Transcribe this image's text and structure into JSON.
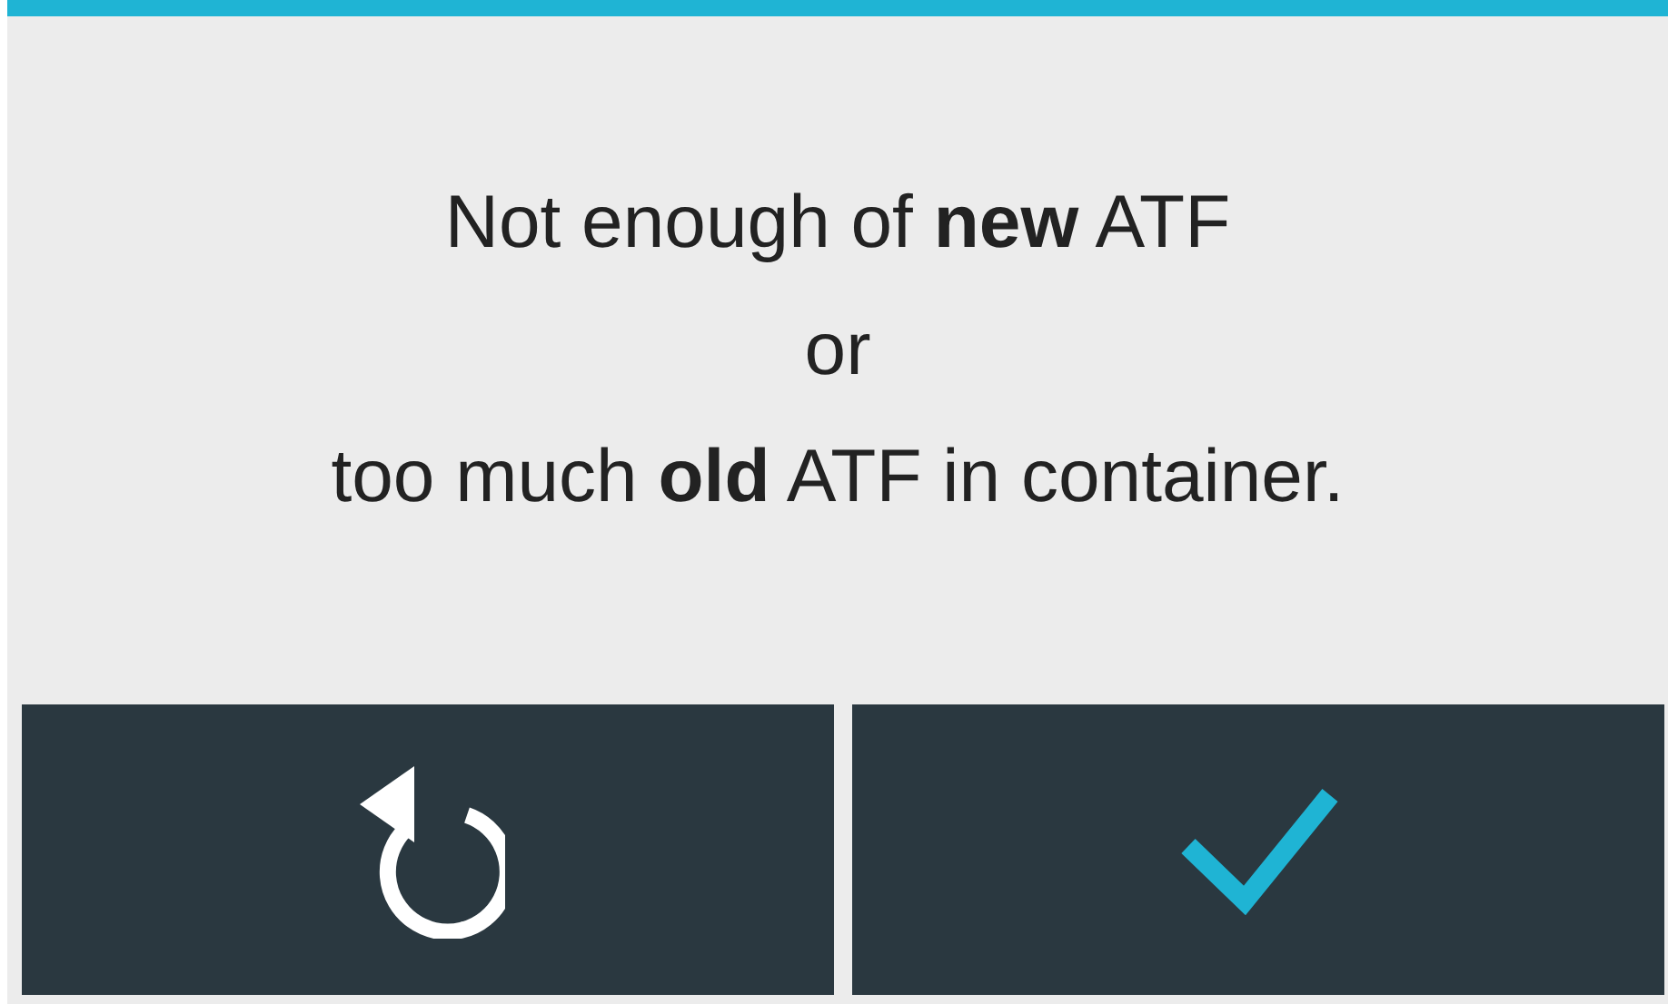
{
  "message": {
    "lines": [
      "Not enough of **new** ATF",
      "or",
      "too much **old** ATF in container."
    ]
  },
  "buttons": [
    {
      "kind": "undo"
    },
    {
      "kind": "confirm"
    }
  ]
}
